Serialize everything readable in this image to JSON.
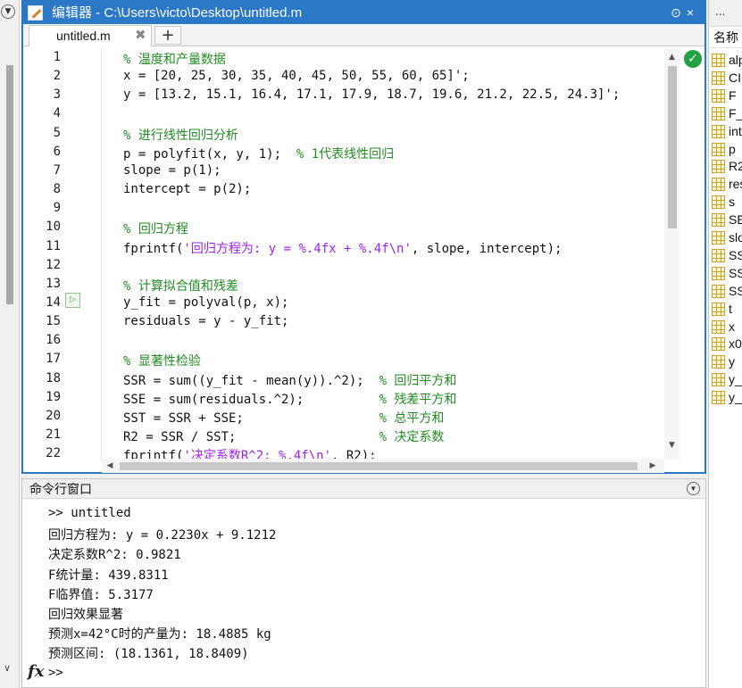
{
  "editor": {
    "title": "编辑器 - C:\\Users\\victo\\Desktop\\untitled.m",
    "title_buttons": "⊙×",
    "tab_label": "untitled.m",
    "code_lines": [
      {
        "n": "1",
        "parts": [
          {
            "t": "% 温度和产量数据",
            "c": "cmt"
          }
        ]
      },
      {
        "n": "2",
        "parts": [
          {
            "t": "x = [20, 25, 30, 35, 40, 45, 50, 55, 60, 65]';",
            "c": ""
          }
        ]
      },
      {
        "n": "3",
        "parts": [
          {
            "t": "y = [13.2, 15.1, 16.4, 17.1, 17.9, 18.7, 19.6, 21.2, 22.5, 24.3]';",
            "c": ""
          }
        ]
      },
      {
        "n": "4",
        "parts": []
      },
      {
        "n": "5",
        "parts": [
          {
            "t": "% 进行线性回归分析",
            "c": "cmt"
          }
        ]
      },
      {
        "n": "6",
        "parts": [
          {
            "t": "p = polyfit(x, y, 1);  ",
            "c": ""
          },
          {
            "t": "% 1代表线性回归",
            "c": "cmt"
          }
        ]
      },
      {
        "n": "7",
        "parts": [
          {
            "t": "slope = p(1);",
            "c": ""
          }
        ]
      },
      {
        "n": "8",
        "parts": [
          {
            "t": "intercept = p(2);",
            "c": ""
          }
        ]
      },
      {
        "n": "9",
        "parts": []
      },
      {
        "n": "10",
        "parts": [
          {
            "t": "% 回归方程",
            "c": "cmt"
          }
        ]
      },
      {
        "n": "11",
        "parts": [
          {
            "t": "fprintf(",
            "c": ""
          },
          {
            "t": "'回归方程为: y = %.4fx + %.4f\\n'",
            "c": "str"
          },
          {
            "t": ", slope, intercept);",
            "c": ""
          }
        ]
      },
      {
        "n": "12",
        "parts": []
      },
      {
        "n": "13",
        "parts": [
          {
            "t": "% 计算拟合值和残差",
            "c": "cmt"
          }
        ]
      },
      {
        "n": "14",
        "parts": [
          {
            "t": "y_fit = polyval(p, x);",
            "c": ""
          }
        ]
      },
      {
        "n": "15",
        "parts": [
          {
            "t": "residuals = y - y_fit;",
            "c": ""
          }
        ]
      },
      {
        "n": "16",
        "parts": []
      },
      {
        "n": "17",
        "parts": [
          {
            "t": "% 显著性检验",
            "c": "cmt"
          }
        ]
      },
      {
        "n": "18",
        "parts": [
          {
            "t": "SSR = sum((y_fit - mean(y)).^2);  ",
            "c": ""
          },
          {
            "t": "% 回归平方和",
            "c": "cmt"
          }
        ]
      },
      {
        "n": "19",
        "parts": [
          {
            "t": "SSE = sum(residuals.^2);          ",
            "c": ""
          },
          {
            "t": "% 残差平方和",
            "c": "cmt"
          }
        ]
      },
      {
        "n": "20",
        "parts": [
          {
            "t": "SST = SSR + SSE;                  ",
            "c": ""
          },
          {
            "t": "% 总平方和",
            "c": "cmt"
          }
        ]
      },
      {
        "n": "21",
        "parts": [
          {
            "t": "R2 = SSR / SST;                   ",
            "c": ""
          },
          {
            "t": "% 决定系数",
            "c": "cmt"
          }
        ]
      },
      {
        "n": "22",
        "parts": [
          {
            "t": "fprintf(",
            "c": ""
          },
          {
            "t": "'决定系数R^2: %.4f\\n'",
            "c": "str"
          },
          {
            "t": ", R2);",
            "c": ""
          }
        ]
      }
    ]
  },
  "command_window": {
    "title": "命令行窗口",
    "output_lines": [
      ">> untitled",
      "回归方程为: y = 0.2230x + 9.1212",
      "决定系数R^2: 0.9821",
      "F统计量: 439.8311",
      "F临界值: 5.3177",
      "回归效果显著",
      "预测x=42°C时的产量为: 18.4885 kg",
      "预测区间: (18.1361, 18.8409)"
    ],
    "fx_symbol": "fx",
    "prompt": ">>"
  },
  "workspace": {
    "top_label": "...",
    "header": "名称",
    "items": [
      "alpha",
      "CI",
      "F",
      "F_crit",
      "interval",
      "p",
      "R2",
      "residuals",
      "s",
      "SE",
      "slope",
      "SSE",
      "SSR",
      "SST",
      "t",
      "x",
      "x0",
      "y",
      "y_fit",
      "y_pred"
    ]
  }
}
